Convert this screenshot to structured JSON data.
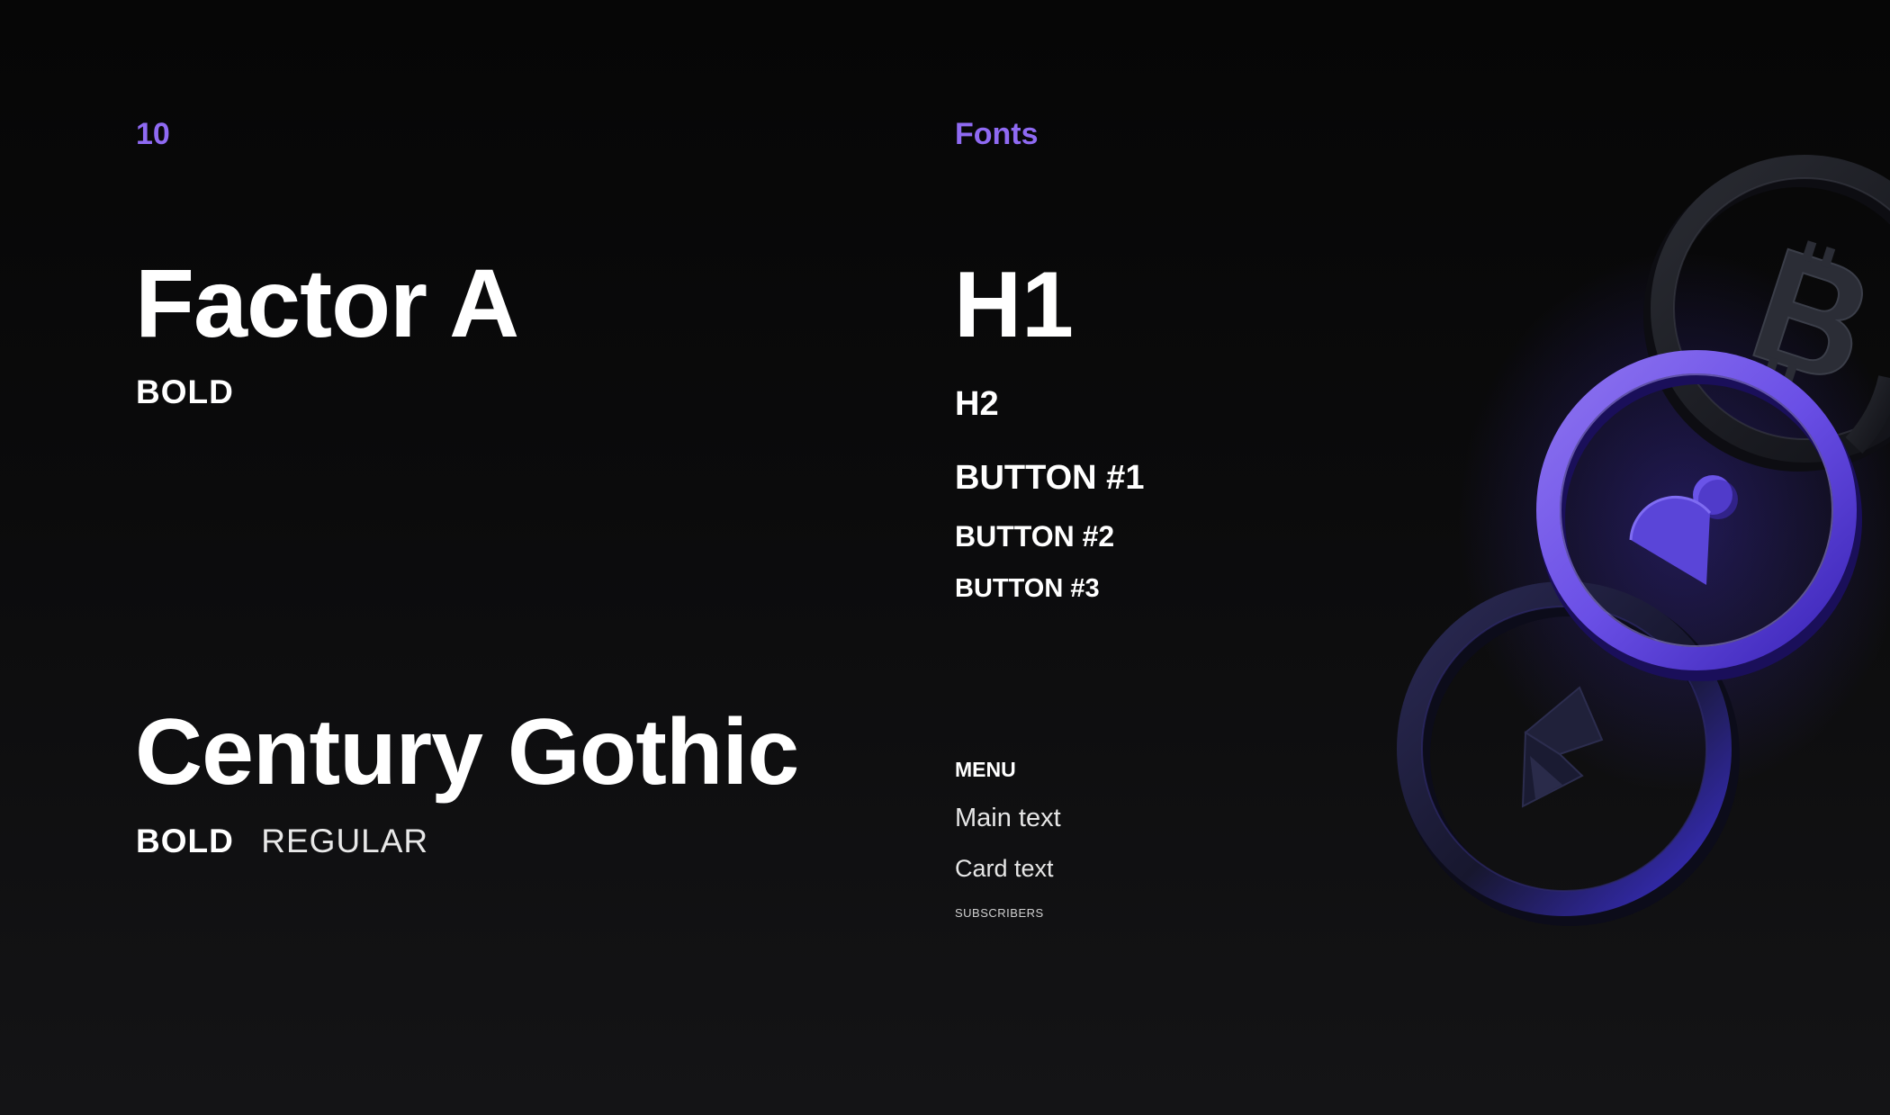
{
  "header": {
    "page_number": "10",
    "section_title": "Fonts"
  },
  "typefaces": [
    {
      "name": "Factor A",
      "weights": [
        "BOLD"
      ]
    },
    {
      "name": "Century Gothic",
      "weights": [
        "BOLD",
        "REGULAR"
      ]
    }
  ],
  "styles": {
    "h1": "H1",
    "h2": "H2",
    "button1": "BUTTON #1",
    "button2": "BUTTON #2",
    "button3": "BUTTON #3",
    "menu": "MENU",
    "main_text": "Main text",
    "card_text": "Card text",
    "subscribers": "SUBSCRIBERS"
  },
  "illustration": {
    "icons": [
      "bitcoin-icon",
      "ethereum-icon",
      "coin-logo-icon"
    ],
    "colors": {
      "accent": "#8f6af3",
      "ring_purple": "#6a4fe6",
      "ring_dark": "#23252c",
      "background": "#0b0b0c"
    }
  }
}
